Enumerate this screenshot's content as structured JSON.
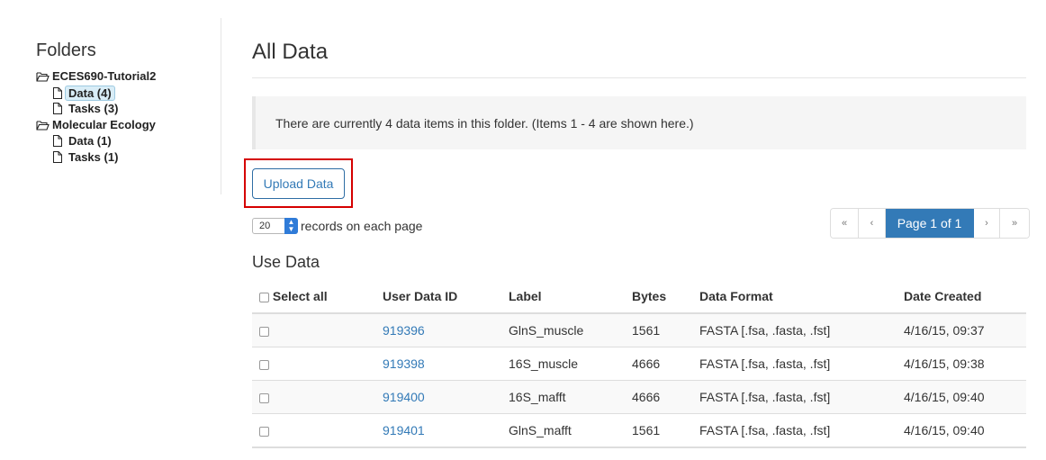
{
  "sidebar": {
    "title": "Folders",
    "folders": [
      {
        "name": "ECES690-Tutorial2",
        "children": [
          {
            "label": "Data (4)",
            "selected": true
          },
          {
            "label": "Tasks (3)"
          }
        ]
      },
      {
        "name": "Molecular Ecology",
        "children": [
          {
            "label": "Data (1)"
          },
          {
            "label": "Tasks (1)"
          }
        ]
      }
    ]
  },
  "main": {
    "title": "All Data",
    "info": "There are currently 4 data items in this folder. (Items 1 - 4 are shown here.)",
    "upload_label": "Upload Data",
    "records_value": "20",
    "records_label": "records on each page",
    "pager": {
      "first": "«",
      "prev": "‹",
      "current": "Page 1 of 1",
      "next": "›",
      "last": "»"
    },
    "section_title": "Use Data",
    "table": {
      "headers": [
        "Select all",
        "User Data ID",
        "Label",
        "Bytes",
        "Data Format",
        "Date Created"
      ],
      "rows": [
        {
          "id": "919396",
          "label": "GlnS_muscle",
          "bytes": "1561",
          "format": "FASTA [.fsa, .fasta, .fst]",
          "date": "4/16/15, 09:37"
        },
        {
          "id": "919398",
          "label": "16S_muscle",
          "bytes": "4666",
          "format": "FASTA [.fsa, .fasta, .fst]",
          "date": "4/16/15, 09:38"
        },
        {
          "id": "919400",
          "label": "16S_mafft",
          "bytes": "4666",
          "format": "FASTA [.fsa, .fasta, .fst]",
          "date": "4/16/15, 09:40"
        },
        {
          "id": "919401",
          "label": "GlnS_mafft",
          "bytes": "1561",
          "format": "FASTA [.fsa, .fasta, .fst]",
          "date": "4/16/15, 09:40"
        }
      ]
    }
  },
  "colors": {
    "link": "#337ab7",
    "active_page": "#337ab7",
    "highlight_border": "#d50000",
    "selected_folder_bg": "#d9edf7"
  },
  "icons": {
    "folder": "folder-open-icon",
    "file": "file-icon"
  }
}
